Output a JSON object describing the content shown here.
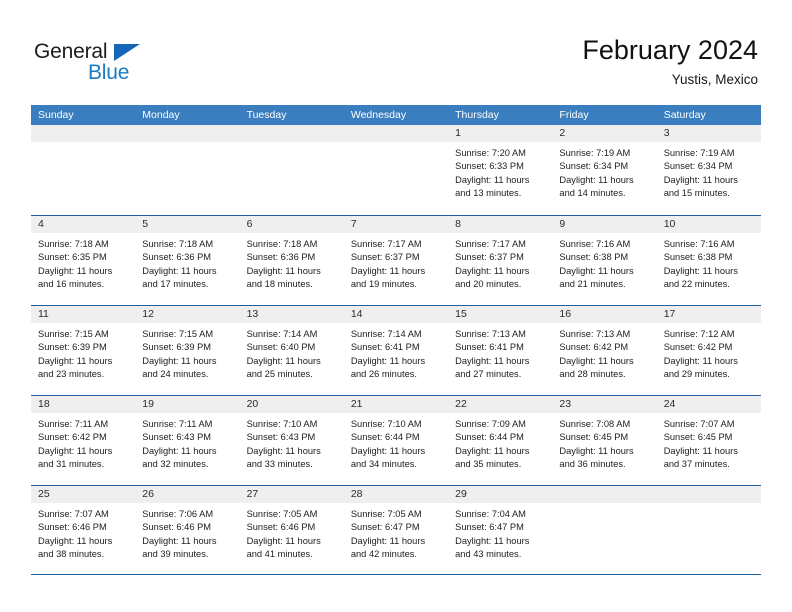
{
  "brand": {
    "name_top": "General",
    "name_bottom": "Blue",
    "triangle_color": "#1565b8",
    "blue_color": "#1b7cc4"
  },
  "header": {
    "title": "February 2024",
    "location": "Yustis, Mexico"
  },
  "colors": {
    "header_bar": "#3a7ebf",
    "row_divider": "#1f5fa0",
    "day_band": "#efefef"
  },
  "weekdays": [
    "Sunday",
    "Monday",
    "Tuesday",
    "Wednesday",
    "Thursday",
    "Friday",
    "Saturday"
  ],
  "weeks": [
    [
      {
        "day": "",
        "lines": []
      },
      {
        "day": "",
        "lines": []
      },
      {
        "day": "",
        "lines": []
      },
      {
        "day": "",
        "lines": []
      },
      {
        "day": "1",
        "lines": [
          "Sunrise: 7:20 AM",
          "Sunset: 6:33 PM",
          "Daylight: 11 hours",
          "and 13 minutes."
        ]
      },
      {
        "day": "2",
        "lines": [
          "Sunrise: 7:19 AM",
          "Sunset: 6:34 PM",
          "Daylight: 11 hours",
          "and 14 minutes."
        ]
      },
      {
        "day": "3",
        "lines": [
          "Sunrise: 7:19 AM",
          "Sunset: 6:34 PM",
          "Daylight: 11 hours",
          "and 15 minutes."
        ]
      }
    ],
    [
      {
        "day": "4",
        "lines": [
          "Sunrise: 7:18 AM",
          "Sunset: 6:35 PM",
          "Daylight: 11 hours",
          "and 16 minutes."
        ]
      },
      {
        "day": "5",
        "lines": [
          "Sunrise: 7:18 AM",
          "Sunset: 6:36 PM",
          "Daylight: 11 hours",
          "and 17 minutes."
        ]
      },
      {
        "day": "6",
        "lines": [
          "Sunrise: 7:18 AM",
          "Sunset: 6:36 PM",
          "Daylight: 11 hours",
          "and 18 minutes."
        ]
      },
      {
        "day": "7",
        "lines": [
          "Sunrise: 7:17 AM",
          "Sunset: 6:37 PM",
          "Daylight: 11 hours",
          "and 19 minutes."
        ]
      },
      {
        "day": "8",
        "lines": [
          "Sunrise: 7:17 AM",
          "Sunset: 6:37 PM",
          "Daylight: 11 hours",
          "and 20 minutes."
        ]
      },
      {
        "day": "9",
        "lines": [
          "Sunrise: 7:16 AM",
          "Sunset: 6:38 PM",
          "Daylight: 11 hours",
          "and 21 minutes."
        ]
      },
      {
        "day": "10",
        "lines": [
          "Sunrise: 7:16 AM",
          "Sunset: 6:38 PM",
          "Daylight: 11 hours",
          "and 22 minutes."
        ]
      }
    ],
    [
      {
        "day": "11",
        "lines": [
          "Sunrise: 7:15 AM",
          "Sunset: 6:39 PM",
          "Daylight: 11 hours",
          "and 23 minutes."
        ]
      },
      {
        "day": "12",
        "lines": [
          "Sunrise: 7:15 AM",
          "Sunset: 6:39 PM",
          "Daylight: 11 hours",
          "and 24 minutes."
        ]
      },
      {
        "day": "13",
        "lines": [
          "Sunrise: 7:14 AM",
          "Sunset: 6:40 PM",
          "Daylight: 11 hours",
          "and 25 minutes."
        ]
      },
      {
        "day": "14",
        "lines": [
          "Sunrise: 7:14 AM",
          "Sunset: 6:41 PM",
          "Daylight: 11 hours",
          "and 26 minutes."
        ]
      },
      {
        "day": "15",
        "lines": [
          "Sunrise: 7:13 AM",
          "Sunset: 6:41 PM",
          "Daylight: 11 hours",
          "and 27 minutes."
        ]
      },
      {
        "day": "16",
        "lines": [
          "Sunrise: 7:13 AM",
          "Sunset: 6:42 PM",
          "Daylight: 11 hours",
          "and 28 minutes."
        ]
      },
      {
        "day": "17",
        "lines": [
          "Sunrise: 7:12 AM",
          "Sunset: 6:42 PM",
          "Daylight: 11 hours",
          "and 29 minutes."
        ]
      }
    ],
    [
      {
        "day": "18",
        "lines": [
          "Sunrise: 7:11 AM",
          "Sunset: 6:42 PM",
          "Daylight: 11 hours",
          "and 31 minutes."
        ]
      },
      {
        "day": "19",
        "lines": [
          "Sunrise: 7:11 AM",
          "Sunset: 6:43 PM",
          "Daylight: 11 hours",
          "and 32 minutes."
        ]
      },
      {
        "day": "20",
        "lines": [
          "Sunrise: 7:10 AM",
          "Sunset: 6:43 PM",
          "Daylight: 11 hours",
          "and 33 minutes."
        ]
      },
      {
        "day": "21",
        "lines": [
          "Sunrise: 7:10 AM",
          "Sunset: 6:44 PM",
          "Daylight: 11 hours",
          "and 34 minutes."
        ]
      },
      {
        "day": "22",
        "lines": [
          "Sunrise: 7:09 AM",
          "Sunset: 6:44 PM",
          "Daylight: 11 hours",
          "and 35 minutes."
        ]
      },
      {
        "day": "23",
        "lines": [
          "Sunrise: 7:08 AM",
          "Sunset: 6:45 PM",
          "Daylight: 11 hours",
          "and 36 minutes."
        ]
      },
      {
        "day": "24",
        "lines": [
          "Sunrise: 7:07 AM",
          "Sunset: 6:45 PM",
          "Daylight: 11 hours",
          "and 37 minutes."
        ]
      }
    ],
    [
      {
        "day": "25",
        "lines": [
          "Sunrise: 7:07 AM",
          "Sunset: 6:46 PM",
          "Daylight: 11 hours",
          "and 38 minutes."
        ]
      },
      {
        "day": "26",
        "lines": [
          "Sunrise: 7:06 AM",
          "Sunset: 6:46 PM",
          "Daylight: 11 hours",
          "and 39 minutes."
        ]
      },
      {
        "day": "27",
        "lines": [
          "Sunrise: 7:05 AM",
          "Sunset: 6:46 PM",
          "Daylight: 11 hours",
          "and 41 minutes."
        ]
      },
      {
        "day": "28",
        "lines": [
          "Sunrise: 7:05 AM",
          "Sunset: 6:47 PM",
          "Daylight: 11 hours",
          "and 42 minutes."
        ]
      },
      {
        "day": "29",
        "lines": [
          "Sunrise: 7:04 AM",
          "Sunset: 6:47 PM",
          "Daylight: 11 hours",
          "and 43 minutes."
        ]
      },
      {
        "day": "",
        "lines": []
      },
      {
        "day": "",
        "lines": []
      }
    ]
  ]
}
